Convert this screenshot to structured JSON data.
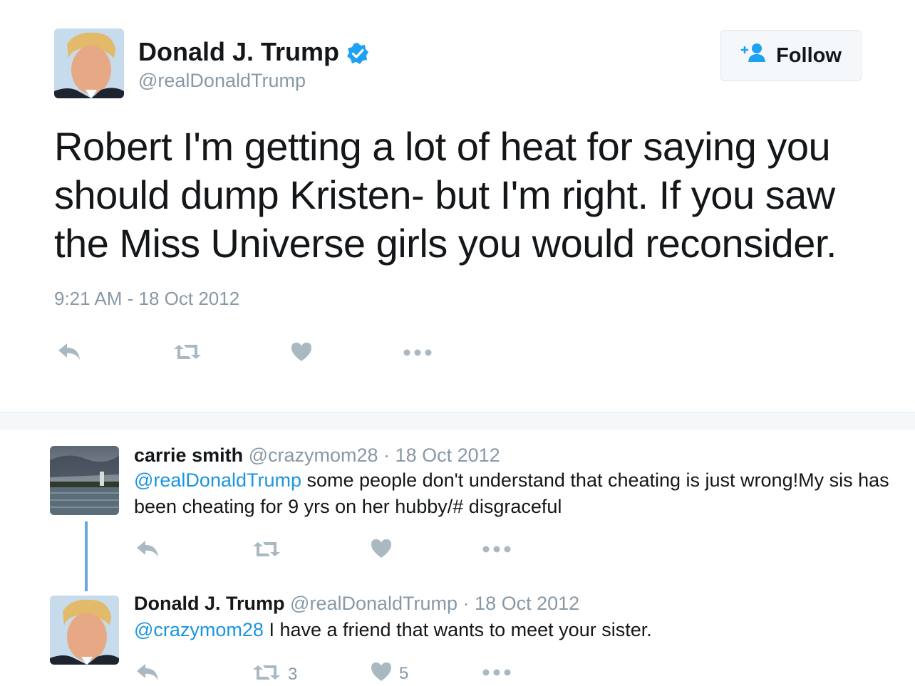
{
  "main_tweet": {
    "author_name": "Donald J. Trump",
    "author_handle": "@realDonaldTrump",
    "follow_label": "Follow",
    "text": "Robert I'm getting a lot of heat for saying you should dump Kristen- but I'm right. If you saw the Miss Universe girls you would reconsider.",
    "timestamp": "9:21 AM - 18 Oct 2012"
  },
  "replies": [
    {
      "author_name": "carrie smith",
      "author_handle": "@crazymom28",
      "date": "· 18 Oct 2012",
      "mention": "@realDonaldTrump",
      "text": " some people don't understand that cheating is just wrong!My sis has been cheating for 9 yrs on her hubby/# disgraceful"
    },
    {
      "author_name": "Donald J. Trump",
      "author_handle": "@realDonaldTrump",
      "date": "· 18 Oct 2012",
      "mention": "@crazymom28",
      "text": " I have a friend that wants to meet your sister.",
      "retweet_count": "3",
      "like_count": "5"
    }
  ],
  "icons": {
    "reply": "reply-icon",
    "retweet": "retweet-icon",
    "like": "heart-icon",
    "more": "more-icon",
    "verified": "verified-badge-icon",
    "follow": "add-user-icon"
  },
  "colors": {
    "link": "#1b95e0",
    "verified": "#1da1f2",
    "muted": "#8899a6",
    "icon": "#aab8c2"
  }
}
